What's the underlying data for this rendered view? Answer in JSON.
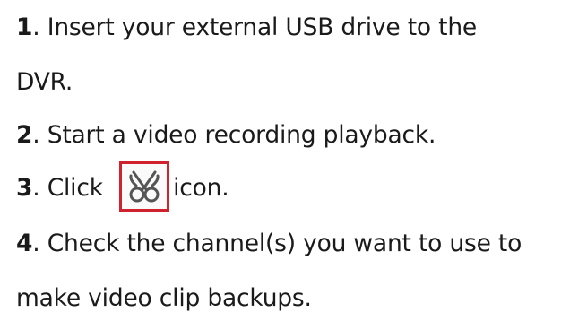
{
  "steps": [
    {
      "number": "1",
      "line1": ". Insert your external USB drive to the",
      "line2": "DVR."
    },
    {
      "number": "2",
      "text": ". Start a video recording playback."
    },
    {
      "number": "3",
      "before_icon": ". Click ",
      "icon": "scissors-clip-icon",
      "after_icon": "icon."
    },
    {
      "number": "4",
      "line1": ". Check the channel(s) you want to use to",
      "line2": "make video clip backups."
    }
  ],
  "colors": {
    "icon_border": "#d0212e",
    "text": "#1a1a1a"
  }
}
